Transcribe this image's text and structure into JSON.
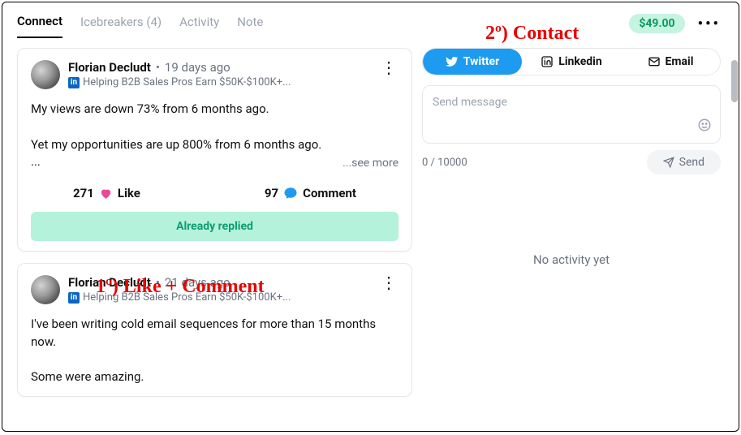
{
  "tabs": {
    "connect": "Connect",
    "icebreakers": "Icebreakers (4)",
    "activity": "Activity",
    "note": "Note"
  },
  "price": "$49.00",
  "posts": [
    {
      "author": "Florian Decludt",
      "age": "19 days ago",
      "tagline": "Helping B2B Sales Pros Earn $50K-$100K+...",
      "body": "My views are down 73% from 6 months ago.\n\nYet my opportunities are up 800% from 6 months ago.\n...",
      "seemore": "...see more",
      "likes": "271",
      "like_label": "Like",
      "comments": "97",
      "comment_label": "Comment",
      "replied": "Already replied"
    },
    {
      "author": "Florian Decludt",
      "age": "21 days ago",
      "tagline": "Helping B2B Sales Pros Earn $50K-$100K+...",
      "body": "I've been writing cold email sequences for more than 15 months now.\n\nSome were amazing."
    }
  ],
  "channels": {
    "twitter": "Twitter",
    "linkedin": "Linkedin",
    "email": "Email"
  },
  "compose": {
    "placeholder": "Send message",
    "counter": "0 / 10000",
    "send": "Send"
  },
  "no_activity": "No activity yet",
  "annotations": {
    "a1": "1º) Like + Comment",
    "a2": "2º) Contact"
  }
}
